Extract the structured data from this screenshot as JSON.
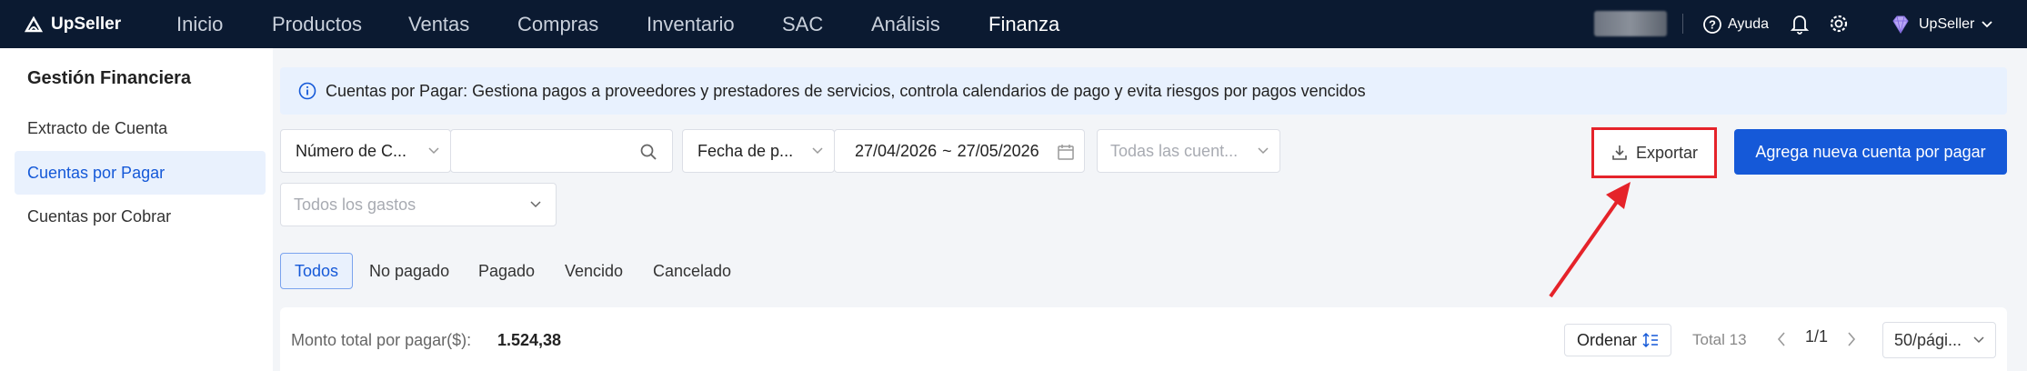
{
  "header": {
    "brand": "UpSeller",
    "nav": [
      "Inicio",
      "Productos",
      "Ventas",
      "Compras",
      "Inventario",
      "SAC",
      "Análisis",
      "Finanza"
    ],
    "active_nav": "Finanza",
    "help_label": "Ayuda",
    "user_label": "UpSeller"
  },
  "sidebar": {
    "title": "Gestión Financiera",
    "items": [
      {
        "label": "Extracto de Cuenta"
      },
      {
        "label": "Cuentas por Pagar"
      },
      {
        "label": "Cuentas por Cobrar"
      }
    ],
    "active_item": "Cuentas por Pagar"
  },
  "banner": {
    "text": "Cuentas por Pagar: Gestiona pagos a proveedores y prestadores de servicios, controla calendarios de pago y evita riesgos por pagos vencidos"
  },
  "filters": {
    "search_field_select": "Número de C...",
    "search_input_value": "",
    "date_type_select": "Fecha de p...",
    "date_from": "27/04/2026",
    "date_sep": "~",
    "date_to": "27/05/2026",
    "account_placeholder": "Todas las cuent...",
    "expense_placeholder": "Todos los gastos"
  },
  "actions": {
    "export_label": "Exportar",
    "add_label": "Agrega nueva cuenta por pagar"
  },
  "tabs": [
    "Todos",
    "No pagado",
    "Pagado",
    "Vencido",
    "Cancelado"
  ],
  "active_tab": "Todos",
  "summary": {
    "total_label": "Monto total por pagar($):",
    "total_value": "1.524,38",
    "sort_label": "Ordenar",
    "total_count": "Total 13",
    "page_indicator": "1/1",
    "per_page": "50/pági..."
  },
  "colors": {
    "topbar": "#0b1a31",
    "primary": "#1559d8",
    "highlight": "#e5232a"
  }
}
